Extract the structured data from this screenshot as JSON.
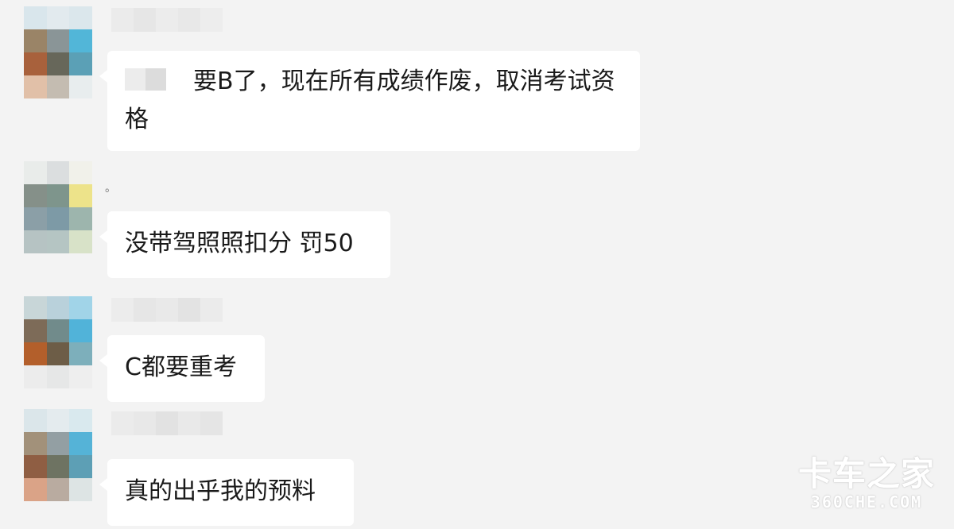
{
  "messages": [
    {
      "text": "要B了，现在所有成绩作废，取消考试资格",
      "has_mention": true
    },
    {
      "sender_name": "。",
      "text": "没带驾照照扣分 罚50"
    },
    {
      "text": "C都要重考"
    },
    {
      "text": "真的出乎我的预料"
    }
  ],
  "avatars": [
    [
      "#d9e6ec",
      "#e2eaee",
      "#dbe7ec",
      "#9a8467",
      "#8a9597",
      "#52b6d8",
      "#a8613c",
      "#67675a",
      "#5ba0b6",
      "#e1c0a8",
      "#c4bcb1",
      "#e8edee"
    ],
    [
      "#e9ecea",
      "#dbdedf",
      "#f1f1ea",
      "#859089",
      "#7e958c",
      "#ede38a",
      "#8b9fa7",
      "#7d9aa6",
      "#9db5ad",
      "#b6c3c3",
      "#b5c5c3",
      "#d8e2c8"
    ],
    [
      "#c8d6d8",
      "#b9d1db",
      "#a1d4e8",
      "#7d6b58",
      "#718b8b",
      "#51b3d9",
      "#b35f2b",
      "#6d5d47",
      "#7dafbb",
      "#ececec",
      "#e6e7e7",
      "#eeeeee"
    ],
    [
      "#dbe6ea",
      "#e4ebee",
      "#d9e9ee",
      "#a2917a",
      "#939fa3",
      "#55b3d7",
      "#8f5e43",
      "#6e7362",
      "#5d9fb5",
      "#daa387",
      "#b9aba0",
      "#dde4e4"
    ]
  ],
  "watermark": {
    "brand_cn": "卡车之家",
    "brand_en": "360CHE.COM"
  }
}
